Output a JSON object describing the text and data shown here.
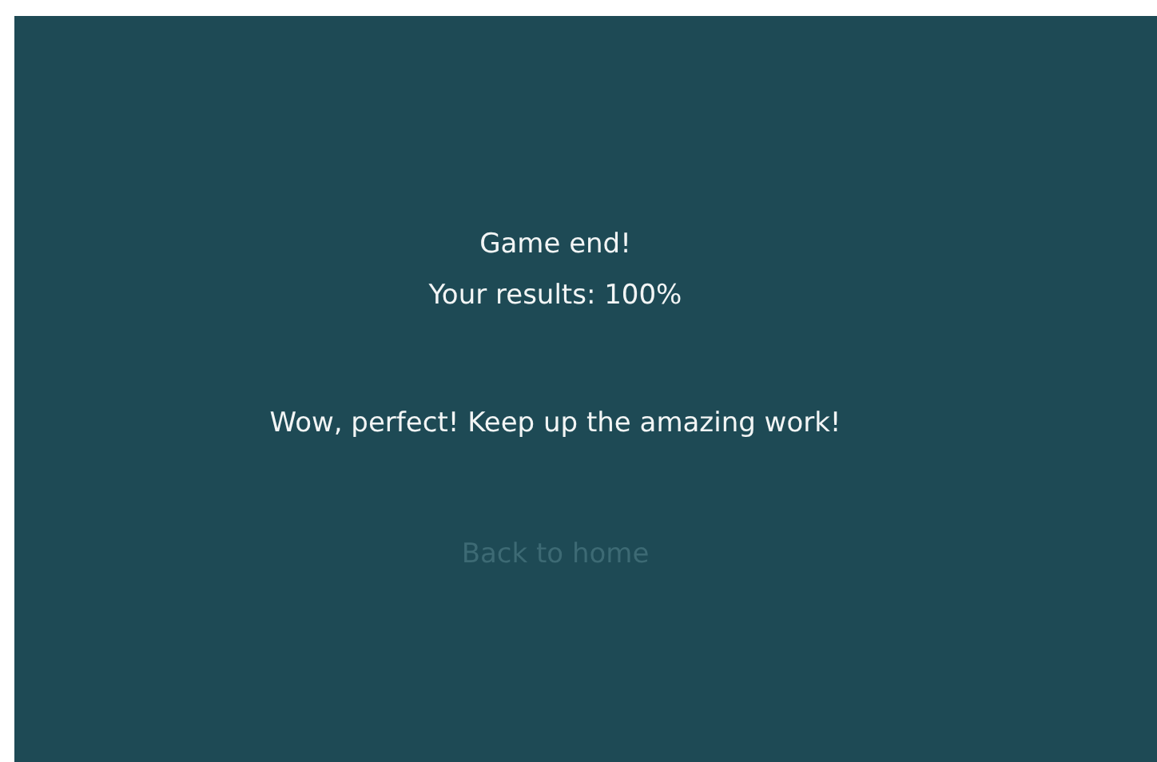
{
  "result": {
    "heading": "Game end!",
    "score_line": "Your results: 100%"
  },
  "message": "Wow, perfect! Keep up the amazing work!",
  "back_button": {
    "label": "Back to home",
    "disabled": true
  }
}
